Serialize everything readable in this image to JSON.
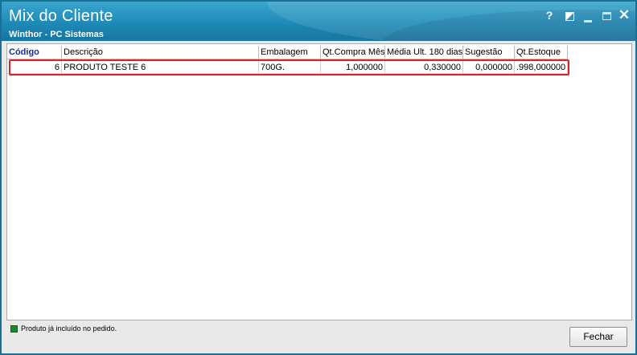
{
  "window": {
    "title": "Mix do Cliente",
    "subtitle": "Winthor - PC Sistemas",
    "controls": {
      "help": "?",
      "close": "✕"
    }
  },
  "grid": {
    "columns": [
      "Código",
      "Descrição",
      "Embalagem",
      "Qt.Compra Mês",
      "Média Ult. 180 dias",
      "Sugestão",
      "Qt.Estoque"
    ],
    "rows": [
      {
        "codigo": "6",
        "descricao": "PRODUTO TESTE 6",
        "embalagem": "700G.",
        "qt_compra_mes": "1,000000",
        "media_180": "0,330000",
        "sugestao": "0,000000",
        "qt_estoque": ".998,000000"
      }
    ]
  },
  "legend": {
    "text": "Produto já incluído no pedido.",
    "color": "#1b8a2e"
  },
  "buttons": {
    "fechar": "Fechar"
  },
  "colors": {
    "titlebar": "#1e8ab7",
    "highlight_border": "#e0202c",
    "header_selected": "#1a2f8a"
  }
}
